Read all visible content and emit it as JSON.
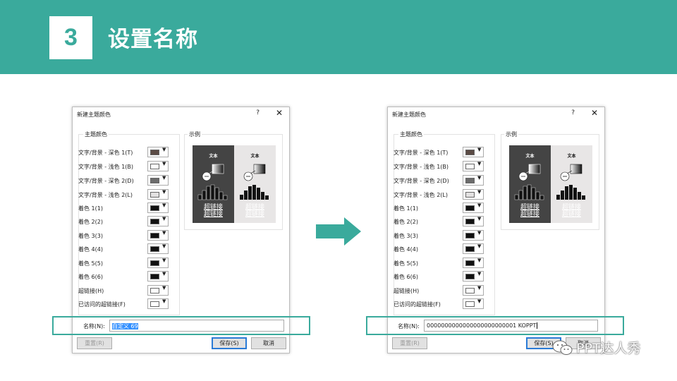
{
  "header": {
    "number": "3",
    "title": "设置名称"
  },
  "dialog": {
    "title": "新建主题颜色",
    "help": "?",
    "close": "✕",
    "group_theme": "主题颜色",
    "group_sample": "示例",
    "sample_text": "文本",
    "sample_link": "超链接",
    "rows": [
      {
        "label": "文字/背景 - 深色 1(T)",
        "swatch": "#5a4a44"
      },
      {
        "label": "文字/背景 - 浅色 1(B)",
        "swatch": "#ffffff"
      },
      {
        "label": "文字/背景 - 深色 2(D)",
        "swatch": "#6b6b6b"
      },
      {
        "label": "文字/背景 - 浅色 2(L)",
        "swatch": "#e3e1e1"
      },
      {
        "label": "着色 1(1)",
        "swatch": "#111111"
      },
      {
        "label": "着色 2(2)",
        "swatch": "#111111"
      },
      {
        "label": "着色 3(3)",
        "swatch": "#111111"
      },
      {
        "label": "着色 4(4)",
        "swatch": "#111111"
      },
      {
        "label": "着色 5(5)",
        "swatch": "#111111"
      },
      {
        "label": "着色 6(6)",
        "swatch": "#111111"
      },
      {
        "label": "超链接(H)",
        "swatch": "#ffffff"
      },
      {
        "label": "已访问的超链接(F)",
        "swatch": "#ffffff"
      }
    ],
    "name_label": "名称(N):",
    "reset_label": "重置(R)",
    "save_label": "保存(S)",
    "cancel_label": "取消"
  },
  "before": {
    "name_value": "自定义 69"
  },
  "after": {
    "name_value": "0000000000000000000000001 KOPPT"
  },
  "watermark": {
    "text": "PPT达人秀"
  },
  "colors": {
    "accent": "#3aaa9c",
    "sample_dark": "#444444",
    "sample_light": "#e8e6e6"
  }
}
